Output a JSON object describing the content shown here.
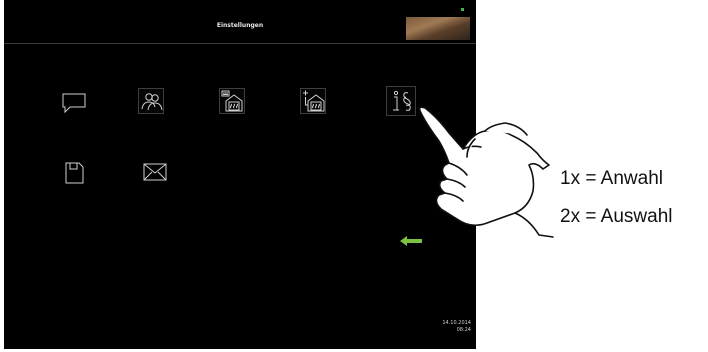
{
  "header": {
    "title": "Einstellungen"
  },
  "icons": [
    {
      "name": "messages-icon"
    },
    {
      "name": "users-icon"
    },
    {
      "name": "sauna-settings-icon"
    },
    {
      "name": "add-sauna-icon"
    },
    {
      "name": "info-legal-icon"
    },
    {
      "name": "save-icon"
    },
    {
      "name": "mail-icon"
    }
  ],
  "navigation": {
    "back_icon": "back-arrow-icon",
    "back_color": "#7dc142"
  },
  "status": {
    "date": "14.10.2014",
    "time": "08:24"
  },
  "instructions": {
    "line1": "1x  = Anwahl",
    "line2": "2x = Auswahl"
  }
}
